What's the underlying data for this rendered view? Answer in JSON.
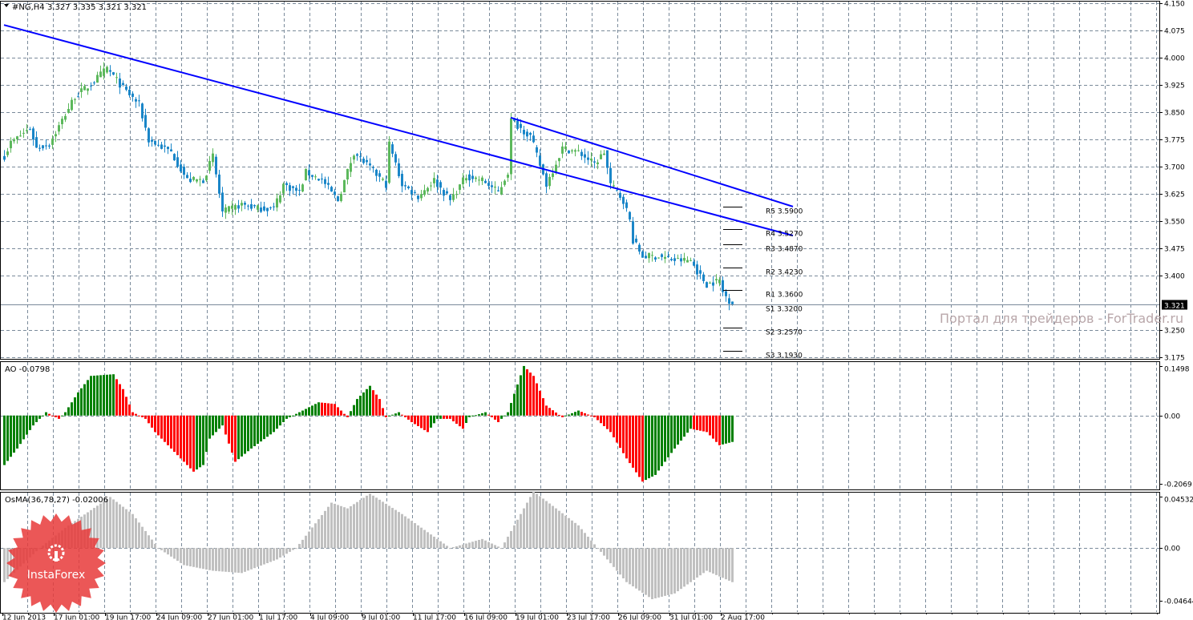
{
  "header": {
    "symbol_label": "#NG,H4",
    "ohlc": "3.327 3.335 3.321 3.321"
  },
  "watermark": "Портал для трейдеров - ForTrader.ru",
  "logo_text": "InstaForex",
  "colors": {
    "bull": "#5cb85c",
    "bear": "#1a86c8",
    "trend": "#0000ff",
    "ao_up": "#008000",
    "ao_down": "#ff0000",
    "osma": "#c0c0c0",
    "grid": "#7a8a9a"
  },
  "chart_data": [
    {
      "type": "candlestick",
      "title": "#NG,H4",
      "ylim": [
        3.175,
        4.15
      ],
      "yticks": [
        "4.150",
        "4.075",
        "4.000",
        "3.925",
        "3.850",
        "3.775",
        "3.700",
        "3.625",
        "3.550",
        "3.475",
        "3.400",
        "3.250",
        "3.175"
      ],
      "current_price": "3.321",
      "bars": 228,
      "close_keypoints": [
        [
          0,
          3.729
        ],
        [
          2,
          3.766
        ],
        [
          8,
          3.806
        ],
        [
          10,
          3.751
        ],
        [
          14,
          3.762
        ],
        [
          18,
          3.828
        ],
        [
          22,
          3.894
        ],
        [
          27,
          3.927
        ],
        [
          32,
          3.971
        ],
        [
          37,
          3.916
        ],
        [
          42,
          3.872
        ],
        [
          45,
          3.773
        ],
        [
          52,
          3.74
        ],
        [
          57,
          3.663
        ],
        [
          62,
          3.663
        ],
        [
          65,
          3.729
        ],
        [
          68,
          3.574
        ],
        [
          74,
          3.596
        ],
        [
          79,
          3.585
        ],
        [
          84,
          3.585
        ],
        [
          87,
          3.651
        ],
        [
          92,
          3.629
        ],
        [
          94,
          3.685
        ],
        [
          99,
          3.663
        ],
        [
          104,
          3.607
        ],
        [
          109,
          3.74
        ],
        [
          114,
          3.696
        ],
        [
          119,
          3.651
        ],
        [
          120,
          3.762
        ],
        [
          124,
          3.651
        ],
        [
          129,
          3.618
        ],
        [
          134,
          3.663
        ],
        [
          139,
          3.607
        ],
        [
          144,
          3.674
        ],
        [
          149,
          3.663
        ],
        [
          154,
          3.629
        ],
        [
          157,
          3.685
        ],
        [
          158,
          3.828
        ],
        [
          164,
          3.784
        ],
        [
          169,
          3.651
        ],
        [
          174,
          3.751
        ],
        [
          179,
          3.74
        ],
        [
          184,
          3.707
        ],
        [
          187,
          3.74
        ],
        [
          189,
          3.651
        ],
        [
          193,
          3.607
        ],
        [
          195,
          3.552
        ],
        [
          196,
          3.497
        ],
        [
          199,
          3.453
        ],
        [
          204,
          3.453
        ],
        [
          209,
          3.442
        ],
        [
          214,
          3.442
        ],
        [
          217,
          3.398
        ],
        [
          219,
          3.376
        ],
        [
          223,
          3.387
        ],
        [
          224,
          3.354
        ],
        [
          227,
          3.321
        ]
      ],
      "trendlines": [
        {
          "from": [
            0,
            4.09
          ],
          "to": [
            246,
            3.51
          ]
        },
        {
          "from": [
            158,
            3.835
          ],
          "to": [
            246,
            3.59
          ]
        }
      ],
      "pivots": [
        {
          "label": "R5 3.5900",
          "value": 3.59
        },
        {
          "label": "R4 3.5270",
          "value": 3.527
        },
        {
          "label": "R3 3.4870",
          "value": 3.487
        },
        {
          "label": "R2 3.4230",
          "value": 3.423
        },
        {
          "label": "R1 3.3600",
          "value": 3.36
        },
        {
          "label": "S1 3.3200",
          "value": 3.32
        },
        {
          "label": "S2 3.2570",
          "value": 3.257
        },
        {
          "label": "S3 3.1930",
          "value": 3.193
        }
      ],
      "xticks": [
        "12 Jun 2013",
        "17 Jun 01:00",
        "19 Jun 17:00",
        "24 Jun 09:00",
        "27 Jun 01:00",
        "1 Jul 17:00",
        "4 Jul 09:00",
        "9 Jul 01:00",
        "11 Jul 17:00",
        "16 Jul 09:00",
        "19 Jul 01:00",
        "23 Jul 17:00",
        "26 Jul 09:00",
        "31 Jul 01:00",
        "2 Aug 17:00"
      ]
    },
    {
      "type": "bar",
      "title": "AO -0.0798",
      "ylim": [
        -0.2069,
        0.1498
      ],
      "yticks": [
        "0.1498",
        "0.00",
        "-0.2069"
      ],
      "keypoints": [
        [
          0,
          -0.15
        ],
        [
          4,
          -0.1
        ],
        [
          9,
          -0.03
        ],
        [
          12,
          0.0
        ],
        [
          13,
          0.01
        ],
        [
          17,
          -0.01
        ],
        [
          19,
          0.01
        ],
        [
          23,
          0.07
        ],
        [
          27,
          0.12
        ],
        [
          34,
          0.125
        ],
        [
          37,
          0.08
        ],
        [
          40,
          0.01
        ],
        [
          44,
          -0.01
        ],
        [
          47,
          -0.05
        ],
        [
          52,
          -0.1
        ],
        [
          59,
          -0.17
        ],
        [
          62,
          -0.15
        ],
        [
          64,
          -0.07
        ],
        [
          68,
          -0.03
        ],
        [
          72,
          -0.14
        ],
        [
          77,
          -0.1
        ],
        [
          84,
          -0.05
        ],
        [
          88,
          -0.01
        ],
        [
          92,
          0.01
        ],
        [
          98,
          0.04
        ],
        [
          103,
          0.035
        ],
        [
          107,
          -0.005
        ],
        [
          110,
          0.05
        ],
        [
          114,
          0.09
        ],
        [
          117,
          0.05
        ],
        [
          119,
          -0.005
        ],
        [
          123,
          0.01
        ],
        [
          127,
          -0.02
        ],
        [
          132,
          -0.05
        ],
        [
          135,
          -0.01
        ],
        [
          139,
          -0.01
        ],
        [
          143,
          -0.04
        ],
        [
          145,
          -0.005
        ],
        [
          150,
          0.01
        ],
        [
          154,
          -0.02
        ],
        [
          157,
          0.01
        ],
        [
          162,
          0.15
        ],
        [
          165,
          0.12
        ],
        [
          169,
          0.03
        ],
        [
          174,
          -0.005
        ],
        [
          179,
          0.015
        ],
        [
          184,
          -0.005
        ],
        [
          189,
          -0.05
        ],
        [
          194,
          -0.13
        ],
        [
          199,
          -0.2
        ],
        [
          203,
          -0.18
        ],
        [
          209,
          -0.1
        ],
        [
          214,
          -0.04
        ],
        [
          219,
          -0.05
        ],
        [
          223,
          -0.09
        ],
        [
          227,
          -0.08
        ]
      ]
    },
    {
      "type": "bar",
      "title": "OsMA(36,78,27) -0.02006",
      "ylim": [
        -0.04644,
        0.04532
      ],
      "yticks": [
        "0.04532",
        "0.00",
        "-0.04644"
      ],
      "keypoints": [
        [
          0,
          -0.03
        ],
        [
          11,
          0.0
        ],
        [
          20,
          0.02
        ],
        [
          33,
          0.045
        ],
        [
          40,
          0.03
        ],
        [
          48,
          0.0
        ],
        [
          56,
          -0.015
        ],
        [
          65,
          -0.02
        ],
        [
          74,
          -0.022
        ],
        [
          85,
          -0.01
        ],
        [
          91,
          0.0
        ],
        [
          102,
          0.04
        ],
        [
          107,
          0.035
        ],
        [
          114,
          0.048
        ],
        [
          124,
          0.03
        ],
        [
          134,
          0.01
        ],
        [
          139,
          0.0
        ],
        [
          149,
          0.008
        ],
        [
          155,
          0.0
        ],
        [
          165,
          0.05
        ],
        [
          179,
          0.02
        ],
        [
          185,
          0.0
        ],
        [
          194,
          -0.03
        ],
        [
          202,
          -0.045
        ],
        [
          209,
          -0.04
        ],
        [
          219,
          -0.02
        ],
        [
          227,
          -0.03
        ]
      ]
    }
  ]
}
